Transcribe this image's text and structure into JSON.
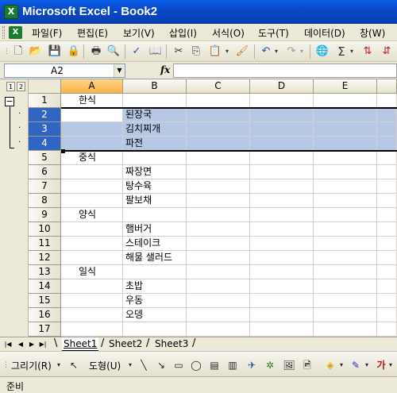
{
  "window": {
    "title": "Microsoft Excel - Book2",
    "app_icon": "excel-icon"
  },
  "menu": {
    "items": [
      "파일(F)",
      "편집(E)",
      "보기(V)",
      "삽입(I)",
      "서식(O)",
      "도구(T)",
      "데이터(D)",
      "창(W)"
    ]
  },
  "toolbar": {
    "zoom_sigma": "Σ"
  },
  "formula_bar": {
    "name_box": "A2",
    "fx": "fx",
    "formula": ""
  },
  "grid": {
    "columns": [
      "A",
      "B",
      "C",
      "D",
      "E"
    ],
    "selected_column": "A",
    "rows": [
      "1",
      "2",
      "3",
      "4",
      "5",
      "6",
      "7",
      "8",
      "9",
      "10",
      "11",
      "12",
      "13",
      "14",
      "15",
      "16",
      "17"
    ],
    "outline_levels": [
      "1",
      "2"
    ],
    "outline_collapse_symbol": "−",
    "outline_dots": [
      "·",
      "·",
      "·"
    ],
    "cells": [
      {
        "row": 1,
        "a": "한식",
        "b": ""
      },
      {
        "row": 2,
        "a": "",
        "b": "된장국"
      },
      {
        "row": 3,
        "a": "",
        "b": "김치찌개"
      },
      {
        "row": 4,
        "a": "",
        "b": "파전"
      },
      {
        "row": 5,
        "a": "중식",
        "b": ""
      },
      {
        "row": 6,
        "a": "",
        "b": "짜장면"
      },
      {
        "row": 7,
        "a": "",
        "b": "탕수육"
      },
      {
        "row": 8,
        "a": "",
        "b": "팔보채"
      },
      {
        "row": 9,
        "a": "양식",
        "b": ""
      },
      {
        "row": 10,
        "a": "",
        "b": "햄버거"
      },
      {
        "row": 11,
        "a": "",
        "b": "스테이크"
      },
      {
        "row": 12,
        "a": "",
        "b": "해물 샐러드"
      },
      {
        "row": 13,
        "a": "일식",
        "b": ""
      },
      {
        "row": 14,
        "a": "",
        "b": "초밥"
      },
      {
        "row": 15,
        "a": "",
        "b": "우동"
      },
      {
        "row": 16,
        "a": "",
        "b": "오뎅"
      },
      {
        "row": 17,
        "a": "",
        "b": ""
      }
    ]
  },
  "sheets": {
    "tabs": [
      "Sheet1",
      "Sheet2",
      "Sheet3"
    ],
    "active": "Sheet1"
  },
  "drawing_toolbar": {
    "draw_label": "그리기(R)",
    "autoshape_label": "도형(U)"
  },
  "status": {
    "text": "준비"
  },
  "colors": {
    "title_bar": "#0842b6",
    "selection": "#b6c8e6",
    "row_header_selected": "#3165c4",
    "col_header_selected": "#f9b447"
  }
}
